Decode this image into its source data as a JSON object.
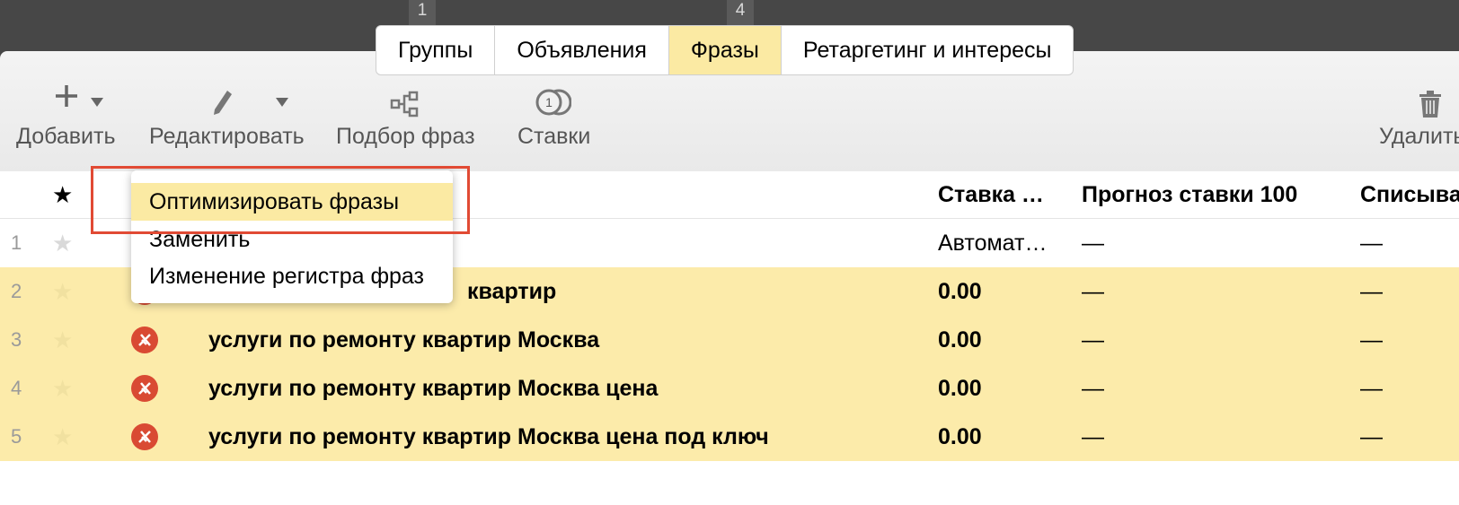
{
  "tab_counts": [
    "1",
    "4"
  ],
  "tabs": [
    {
      "label": "Группы",
      "active": false
    },
    {
      "label": "Объявления",
      "active": false
    },
    {
      "label": "Фразы",
      "active": true
    },
    {
      "label": "Ретаргетинг и интересы",
      "active": false
    }
  ],
  "toolbar": {
    "add_label": "Добавить",
    "edit_label": "Редактировать",
    "phrase_pick_label": "Подбор фраз",
    "bids_label": "Ставки",
    "bids_icon_number": "1",
    "delete_label": "Удалить"
  },
  "table": {
    "header": {
      "star": "★",
      "bid": "Ставка …",
      "forecast": "Прогноз ставки 100",
      "spend": "Списыва"
    },
    "rows": [
      {
        "num": "1",
        "phrase": "",
        "bid": "Автомат…",
        "forecast": "—",
        "spend": "—"
      },
      {
        "num": "2",
        "phrase": "квартир",
        "bid": "0.00",
        "forecast": "—",
        "spend": "—"
      },
      {
        "num": "3",
        "phrase": "услуги по ремонту квартир Москва",
        "bid": "0.00",
        "forecast": "—",
        "spend": "—"
      },
      {
        "num": "4",
        "phrase": "услуги по ремонту квартир Москва цена",
        "bid": "0.00",
        "forecast": "—",
        "spend": "—"
      },
      {
        "num": "5",
        "phrase": "услуги по ремонту квартир Москва цена под ключ",
        "bid": "0.00",
        "forecast": "—",
        "spend": "—"
      }
    ]
  },
  "edit_menu": {
    "items": [
      {
        "label": "Оптимизировать фразы",
        "active": true
      },
      {
        "label": "Заменить",
        "active": false
      },
      {
        "label": "Изменение регистра фраз",
        "active": false
      }
    ]
  },
  "colors": {
    "topbar": "#474747",
    "active_tab": "#fbeaa3",
    "highlight_row": "#fcebaa",
    "stop_icon": "#d94a33",
    "annotation": "#e14a34"
  }
}
